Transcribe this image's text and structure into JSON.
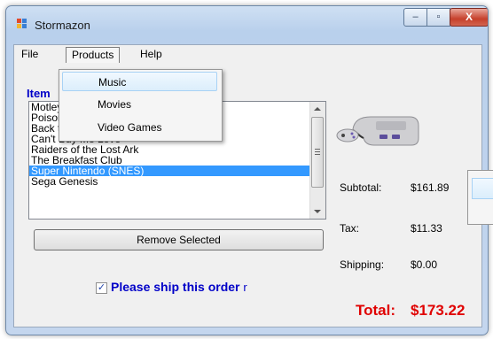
{
  "window": {
    "title": "Stormazon",
    "controls": {
      "minimize": "–",
      "maximize": "▫",
      "close": "X"
    }
  },
  "menu": {
    "items": [
      "File",
      "Products",
      "Help"
    ],
    "active": "Products",
    "dropdown": [
      "Music",
      "Movies",
      "Video Games"
    ],
    "highlighted": "Music"
  },
  "list": {
    "label": "Item",
    "rows": [
      "Motley",
      "Poison",
      "Back to the Future",
      "Can't Buy Me Love",
      "Raiders of the Lost Ark",
      "The Breakfast Club",
      "Super Nintendo (SNES)",
      "Sega Genesis"
    ],
    "selected": "Super Nintendo (SNES)"
  },
  "remove_button": "Remove Selected",
  "ship": {
    "checked": true,
    "label": "Please ship this order",
    "trail": "r"
  },
  "summary": {
    "subtotal_label": "Subtotal:",
    "subtotal": "$161.89",
    "tax_label": "Tax:",
    "tax": "$11.33",
    "shipping_label": "Shipping:",
    "shipping": "$0.00",
    "total_label": "Total:",
    "total": "$173.22"
  },
  "colors": {
    "accent_blue": "#0000c8",
    "total_red": "#e00000",
    "selection": "#3399ff"
  },
  "icons": {
    "app": "app-window-icon",
    "product_image": "snes-console-icon"
  }
}
